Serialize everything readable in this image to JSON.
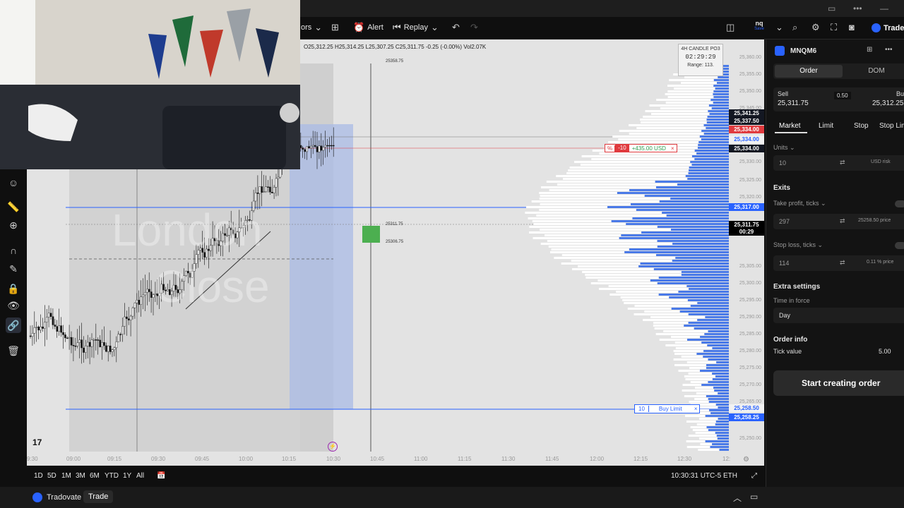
{
  "toolbar": {
    "indicators_label": "ors",
    "alert_label": "Alert",
    "replay_label": "Replay",
    "symbol_short": "nq",
    "symbol_sub": "Save",
    "trade_label": "Trade"
  },
  "chart": {
    "ohlc": "O25,312.25  H25,314.25  L25,307.25  C25,311.75  -0.25 (-0.00%)  Vol2.07K",
    "countdown_title": "4H CANDLE PO3",
    "countdown_time": "02:29:29",
    "countdown_range": "Range: 113.",
    "high_marker": "25358.75",
    "mid_marker_1": "25311.75",
    "mid_marker_2": "25306.75",
    "watermark_line1": "London",
    "watermark_line2": "Close",
    "position_qty": "-10",
    "position_pnl": "+435.00 USD",
    "position_pct": "%",
    "buy_limit_qty": "10",
    "buy_limit_label": "Buy Limit",
    "close_symbol": "×",
    "price_labels": [
      {
        "text": "25,341.25",
        "bg": "#131722"
      },
      {
        "text": "25,337.50",
        "bg": "#131722"
      },
      {
        "text": "25,334.00",
        "bg": "#e03a3e"
      },
      {
        "text": "25,334.00",
        "bg": "#f2f2f2"
      },
      {
        "text": "25,334.00",
        "bg": "#131722"
      },
      {
        "text": "25,317.00",
        "bg": "#2962ff"
      },
      {
        "text": "25,311.75",
        "bg": "#000000"
      },
      {
        "text": "00:29",
        "bg": "#000000"
      },
      {
        "text": "25,258.50",
        "bg": "#f2f2f2"
      },
      {
        "text": "25,258.25",
        "bg": "#2962ff"
      }
    ],
    "axis_prices": [
      "25,360.00",
      "25,355.00",
      "25,350.00",
      "25,345.00",
      "25,330.00",
      "25,325.00",
      "25,320.00",
      "25,305.00",
      "25,300.00",
      "25,295.00",
      "25,290.00",
      "25,285.00",
      "25,280.00",
      "25,275.00",
      "25,270.00",
      "25,265.00",
      "25,260.00",
      "25,250.00"
    ],
    "time_labels": [
      "9:30",
      "09:00",
      "09:15",
      "09:30",
      "09:45",
      "10:00",
      "10:15",
      "10:30",
      "10:45",
      "11:00",
      "11:15",
      "11:30",
      "11:45",
      "12:00",
      "12:15",
      "12:30",
      "12:"
    ]
  },
  "rangebar": {
    "ranges": [
      "1D",
      "5D",
      "1M",
      "3M",
      "6M",
      "YTD",
      "1Y",
      "All"
    ],
    "clock": "10:30:31 UTC-5",
    "session": "ETH"
  },
  "taskbar": {
    "app_label": "Tradovate",
    "trade_label": "Trade"
  },
  "panel": {
    "symbol": "MNQM6",
    "tab_order": "Order",
    "tab_dom": "DOM",
    "sell_label": "Sell",
    "sell_price": "25,311.75",
    "spread": "0.50",
    "buy_label": "Buy",
    "buy_price": "25,312.25",
    "type_market": "Market",
    "type_limit": "Limit",
    "type_stop": "Stop",
    "type_stoplimit": "Stop Limit",
    "units_label": "Units",
    "units_value": "10",
    "units_risk": "USD risk",
    "exits_label": "Exits",
    "tp_label": "Take profit, ticks",
    "tp_value": "297",
    "tp_price": "25258.50 price",
    "sl_label": "Stop loss, ticks",
    "sl_value": "114",
    "sl_price": "0.11 % price",
    "extra_label": "Extra settings",
    "tif_label": "Time in force",
    "tif_value": "Day",
    "order_info_label": "Order info",
    "tick_value_label": "Tick value",
    "tick_value": "5.00",
    "start_button": "Start creating order"
  }
}
